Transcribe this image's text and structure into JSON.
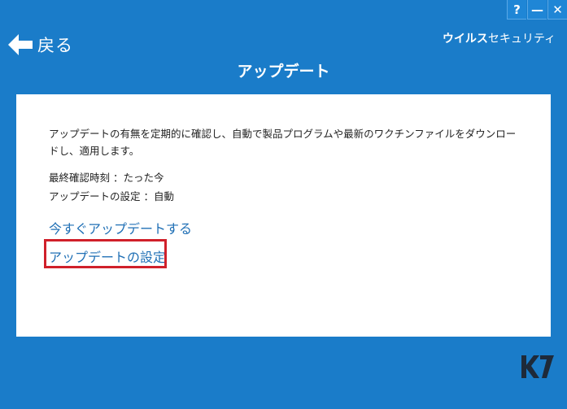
{
  "window": {
    "help_label": "?",
    "minimize_label": "—",
    "close_label": "✕"
  },
  "nav": {
    "back_label": "戻る"
  },
  "brand": {
    "bold": "ウイルス",
    "light": "セキュリティ",
    "logo": "K7"
  },
  "page": {
    "title": "アップデート"
  },
  "panel": {
    "description": "アップデートの有無を定期的に確認し、自動で製品プログラムや最新のワクチンファイルをダウンロードし、適用します。",
    "last_check": "最終確認時刻 ：たった今",
    "update_setting": "アップデートの設定 ：自動",
    "update_now_link": "今すぐアップデートする",
    "settings_link": "アップデートの設定"
  },
  "colors": {
    "background": "#1a7cc9",
    "link": "#1f6fb5",
    "highlight": "#d0202a"
  }
}
